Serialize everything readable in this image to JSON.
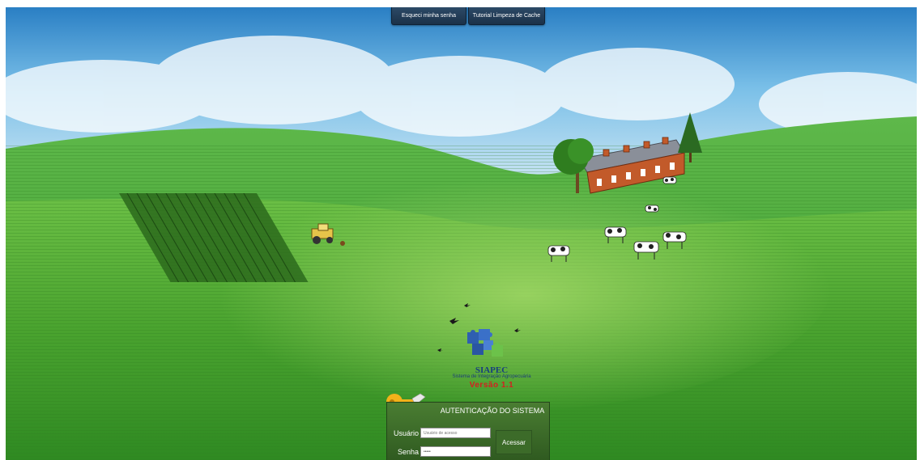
{
  "top_links": {
    "forgot_password": "Esqueci minha senha",
    "cache_tutorial": "Tutorial Limpeza de Cache"
  },
  "logo": {
    "name": "SIAPEC",
    "subtitle": "Sistema de Integração Agropecuária",
    "version": "Versão 1.1"
  },
  "auth": {
    "title": "AUTENTICAÇÃO DO SISTEMA",
    "user_label": "Usuário",
    "user_placeholder": "Usuário de acesso",
    "password_label": "Senha",
    "password_value": "•••••",
    "submit_label": "Acessar"
  },
  "colors": {
    "panel_green": "#3c6b29",
    "button_navy": "#1b3149",
    "version_red": "#d32020",
    "logo_blue": "#173f7e"
  }
}
